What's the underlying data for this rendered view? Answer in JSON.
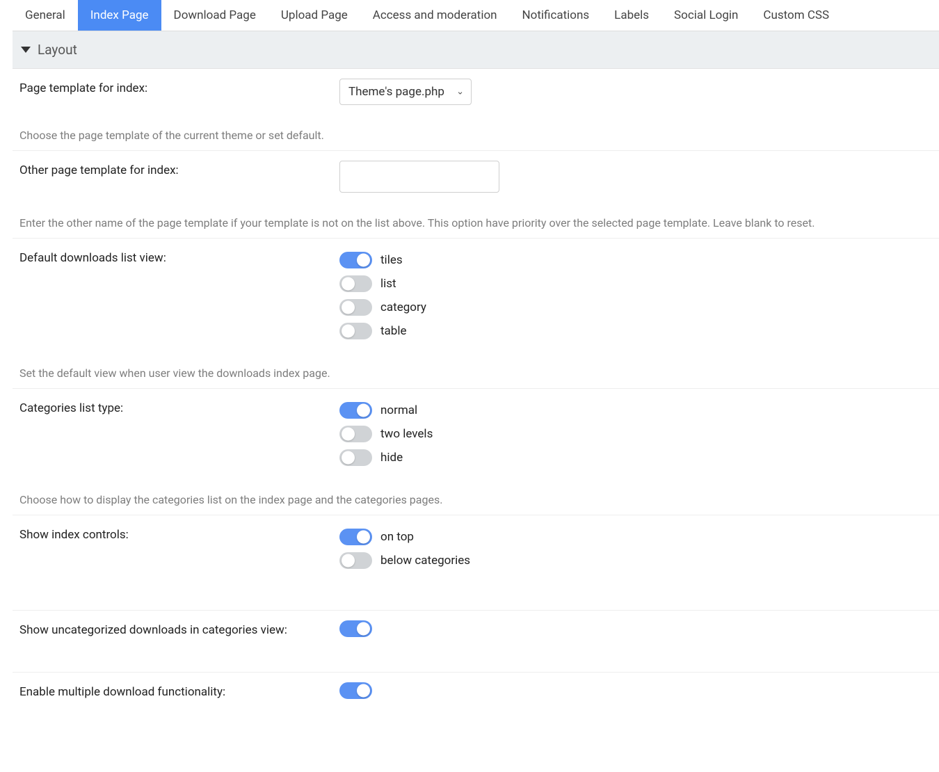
{
  "tabs": [
    {
      "label": "General",
      "active": false
    },
    {
      "label": "Index Page",
      "active": true
    },
    {
      "label": "Download Page",
      "active": false
    },
    {
      "label": "Upload Page",
      "active": false
    },
    {
      "label": "Access and moderation",
      "active": false
    },
    {
      "label": "Notifications",
      "active": false
    },
    {
      "label": "Labels",
      "active": false
    },
    {
      "label": "Social Login",
      "active": false
    },
    {
      "label": "Custom CSS",
      "active": false
    }
  ],
  "section": {
    "title": "Layout"
  },
  "settings": {
    "page_template": {
      "label": "Page template for index:",
      "value": "Theme's page.php",
      "help": "Choose the page template of the current theme or set default."
    },
    "other_template": {
      "label": "Other page template for index:",
      "value": "",
      "help": "Enter the other name of the page template if your template is not on the list above. This option have priority over the selected page template. Leave blank to reset."
    },
    "default_view": {
      "label": "Default downloads list view:",
      "options": [
        {
          "label": "tiles",
          "on": true
        },
        {
          "label": "list",
          "on": false
        },
        {
          "label": "category",
          "on": false
        },
        {
          "label": "table",
          "on": false
        }
      ],
      "help": "Set the default view when user view the downloads index page."
    },
    "categories_type": {
      "label": "Categories list type:",
      "options": [
        {
          "label": "normal",
          "on": true
        },
        {
          "label": "two levels",
          "on": false
        },
        {
          "label": "hide",
          "on": false
        }
      ],
      "help": "Choose how to display the categories list on the index page and the categories pages."
    },
    "index_controls": {
      "label": "Show index controls:",
      "options": [
        {
          "label": "on top",
          "on": true
        },
        {
          "label": "below categories",
          "on": false
        }
      ]
    },
    "show_uncategorized": {
      "label": "Show uncategorized downloads in categories view:",
      "on": true
    },
    "enable_multi": {
      "label": "Enable multiple download functionality:",
      "on": true
    }
  }
}
